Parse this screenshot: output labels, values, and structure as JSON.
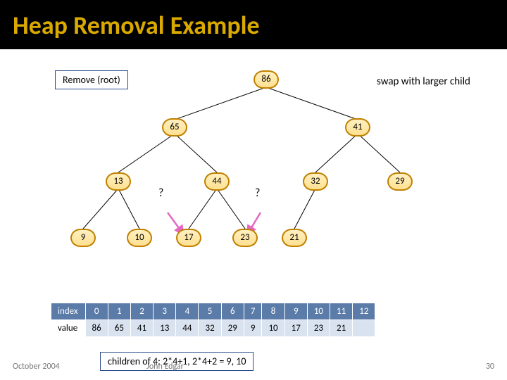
{
  "title": "Heap Removal Example",
  "leftbox": "Remove (root)",
  "rightnote": "swap with larger child",
  "nodes": {
    "n0": "86",
    "n1": "65",
    "n2": "41",
    "n3": "13",
    "n4": "44",
    "n5": "32",
    "n6": "29",
    "n7": "9",
    "n8": "10",
    "n9": "17",
    "n10": "23",
    "n11": "21"
  },
  "qmark": "?",
  "table": {
    "indexLabel": "index",
    "valueLabel": "value",
    "index": [
      "0",
      "1",
      "2",
      "3",
      "4",
      "5",
      "6",
      "7",
      "8",
      "9",
      "10",
      "11",
      "12"
    ],
    "value": [
      "86",
      "65",
      "41",
      "13",
      "44",
      "32",
      "29",
      "9",
      "10",
      "17",
      "23",
      "21",
      ""
    ]
  },
  "childnote": "children of 4: 2*4+1, 2*4+2 = 9, 10",
  "footer": {
    "date": "October 2004",
    "author": "John Edgar",
    "page": "30"
  }
}
